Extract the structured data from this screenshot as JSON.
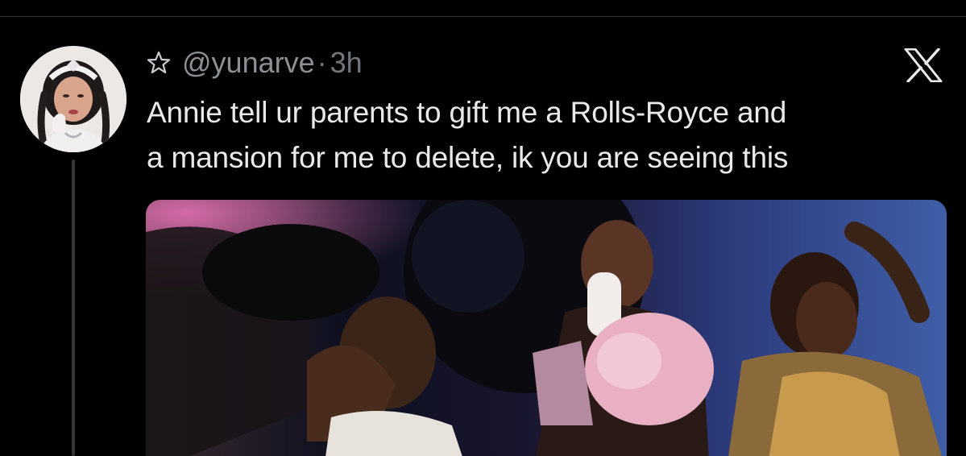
{
  "tweet": {
    "handle": "@yunarve",
    "separator": "·",
    "time": "3h",
    "text_lines": [
      "Annie tell ur parents to gift me a Rolls-Royce and",
      "a mansion for me to delete, ik you are seeing this"
    ]
  },
  "icons": {
    "badge": "star-outline-icon",
    "platform": "x-logo-icon"
  },
  "colors": {
    "background": "#000000",
    "text_primary": "#e7e9ea",
    "text_secondary": "#71767b",
    "divider": "#2f3336"
  }
}
